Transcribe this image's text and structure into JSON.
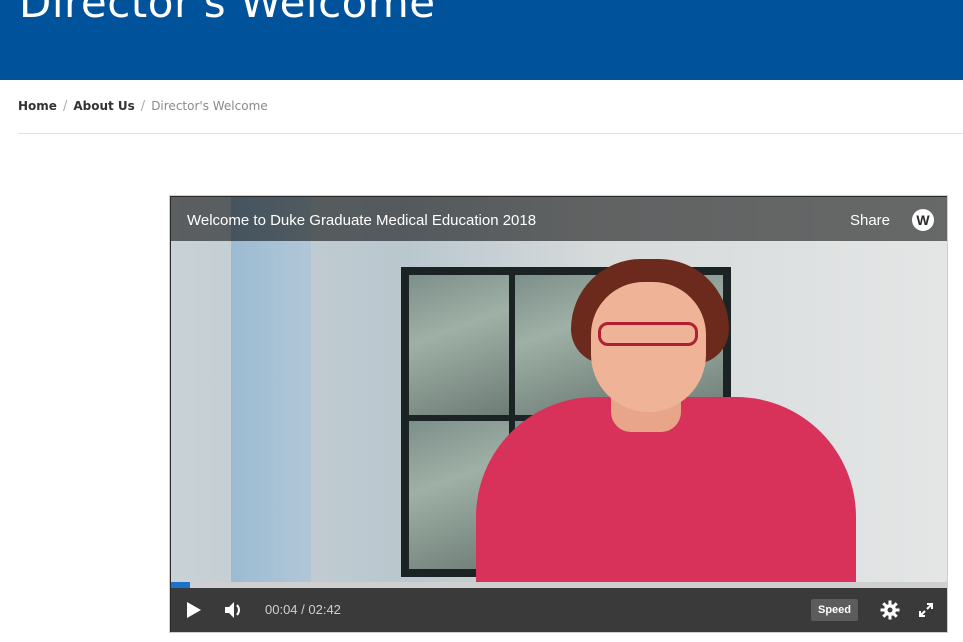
{
  "page": {
    "title": "Director's Welcome"
  },
  "breadcrumb": {
    "home": "Home",
    "about": "About Us",
    "current": "Director's Welcome",
    "separator": "/"
  },
  "video": {
    "title": "Welcome to Duke Graduate Medical Education 2018",
    "share_label": "Share",
    "logo_letter": "W",
    "current_time": "00:04",
    "duration": "02:42",
    "time_display": "00:04 / 02:42",
    "speed_label": "Speed",
    "progress_fraction": 0.025
  },
  "colors": {
    "header_blue": "#00539b",
    "progress_blue": "#1a73c8"
  },
  "icons": {
    "play": "play-icon",
    "volume": "volume-icon",
    "settings": "gear-icon",
    "fullscreen": "fullscreen-icon"
  }
}
